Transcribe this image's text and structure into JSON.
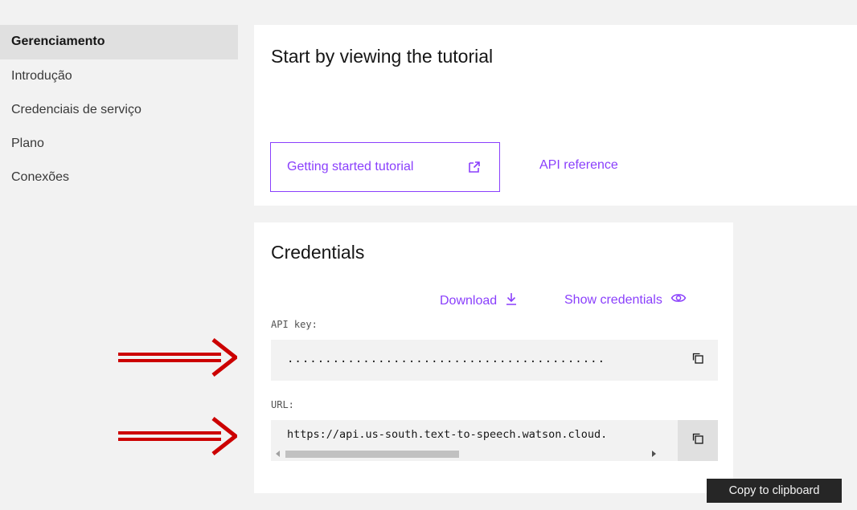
{
  "sidebar": {
    "items": [
      {
        "label": "Gerenciamento",
        "active": true
      },
      {
        "label": "Introdução",
        "active": false
      },
      {
        "label": "Credenciais de serviço",
        "active": false
      },
      {
        "label": "Plano",
        "active": false
      },
      {
        "label": "Conexões",
        "active": false
      }
    ]
  },
  "tutorial": {
    "title": "Start by viewing the tutorial",
    "button_label": "Getting started tutorial",
    "button_icon": "external-link-icon",
    "api_reference_label": "API reference"
  },
  "credentials": {
    "title": "Credentials",
    "download_label": "Download",
    "download_icon": "download-icon",
    "show_label": "Show credentials",
    "show_icon": "eye-icon",
    "api_key_label": "API key:",
    "api_key_value": "··········································",
    "url_label": "URL:",
    "url_value": "https://api.us-south.text-to-speech.watson.cloud.",
    "copy_icon": "copy-icon"
  },
  "tooltip": {
    "text": "Copy to clipboard"
  },
  "colors": {
    "accent": "#8a3ffc",
    "background": "#f2f2f2",
    "card": "#ffffff",
    "arrow": "#cc0000",
    "tooltip_bg": "#262626"
  }
}
